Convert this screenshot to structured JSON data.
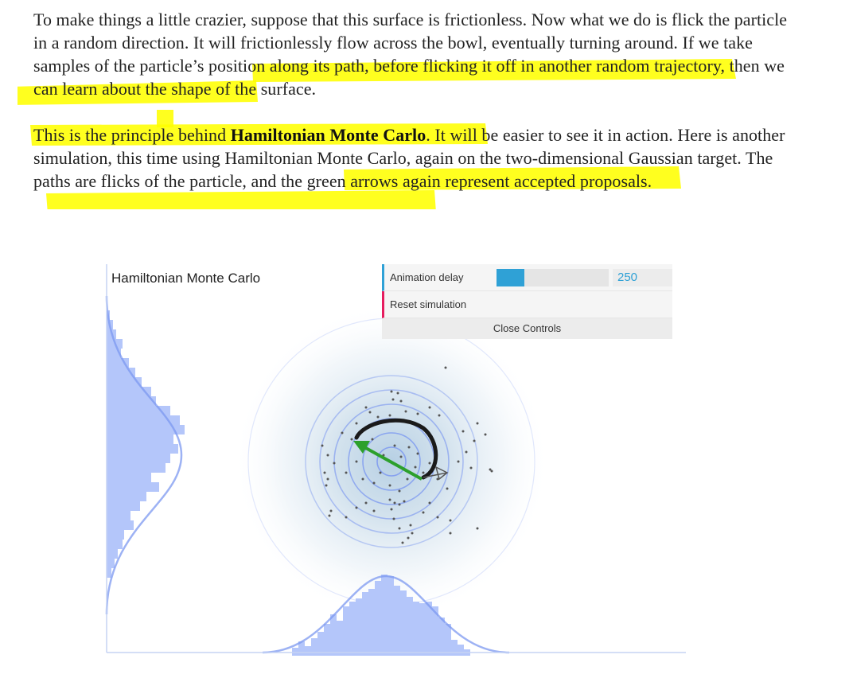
{
  "article": {
    "paragraph1": "To make things a little crazier, suppose that this surface is frictionless. Now what we do is flick the particle in a random direction. It will frictionlessly flow across the bowl, eventually turning around. If we take samples of the particle’s position along its path, before flicking it off in another random trajectory, then we can learn about the shape of the surface.",
    "paragraph2_before": "This is the principle behind ",
    "paragraph2_bold": "Hamiltonian Monte Carlo",
    "paragraph2_after": ". It will be easier to see it in action. Here is another simulation, this time using Hamiltonian Monte Carlo, again on the two-dimensional Gaussian target. The paths are flicks of the particle, and the green arrows again represent accepted proposals.",
    "highlight_color": "#ffff00"
  },
  "simulation": {
    "title": "Hamiltonian Monte Carlo",
    "arrow_color": "#2ca02c",
    "histogram_color": "#b4c6fa",
    "contour_color": "#7c98f0"
  },
  "controls": {
    "delay_label": "Animation delay",
    "delay_value": "250",
    "delay_fraction": 0.25,
    "reset_label": "Reset simulation",
    "close_label": "Close Controls",
    "accent_color": "#2fa1d6",
    "reset_color": "#e61d5f"
  }
}
